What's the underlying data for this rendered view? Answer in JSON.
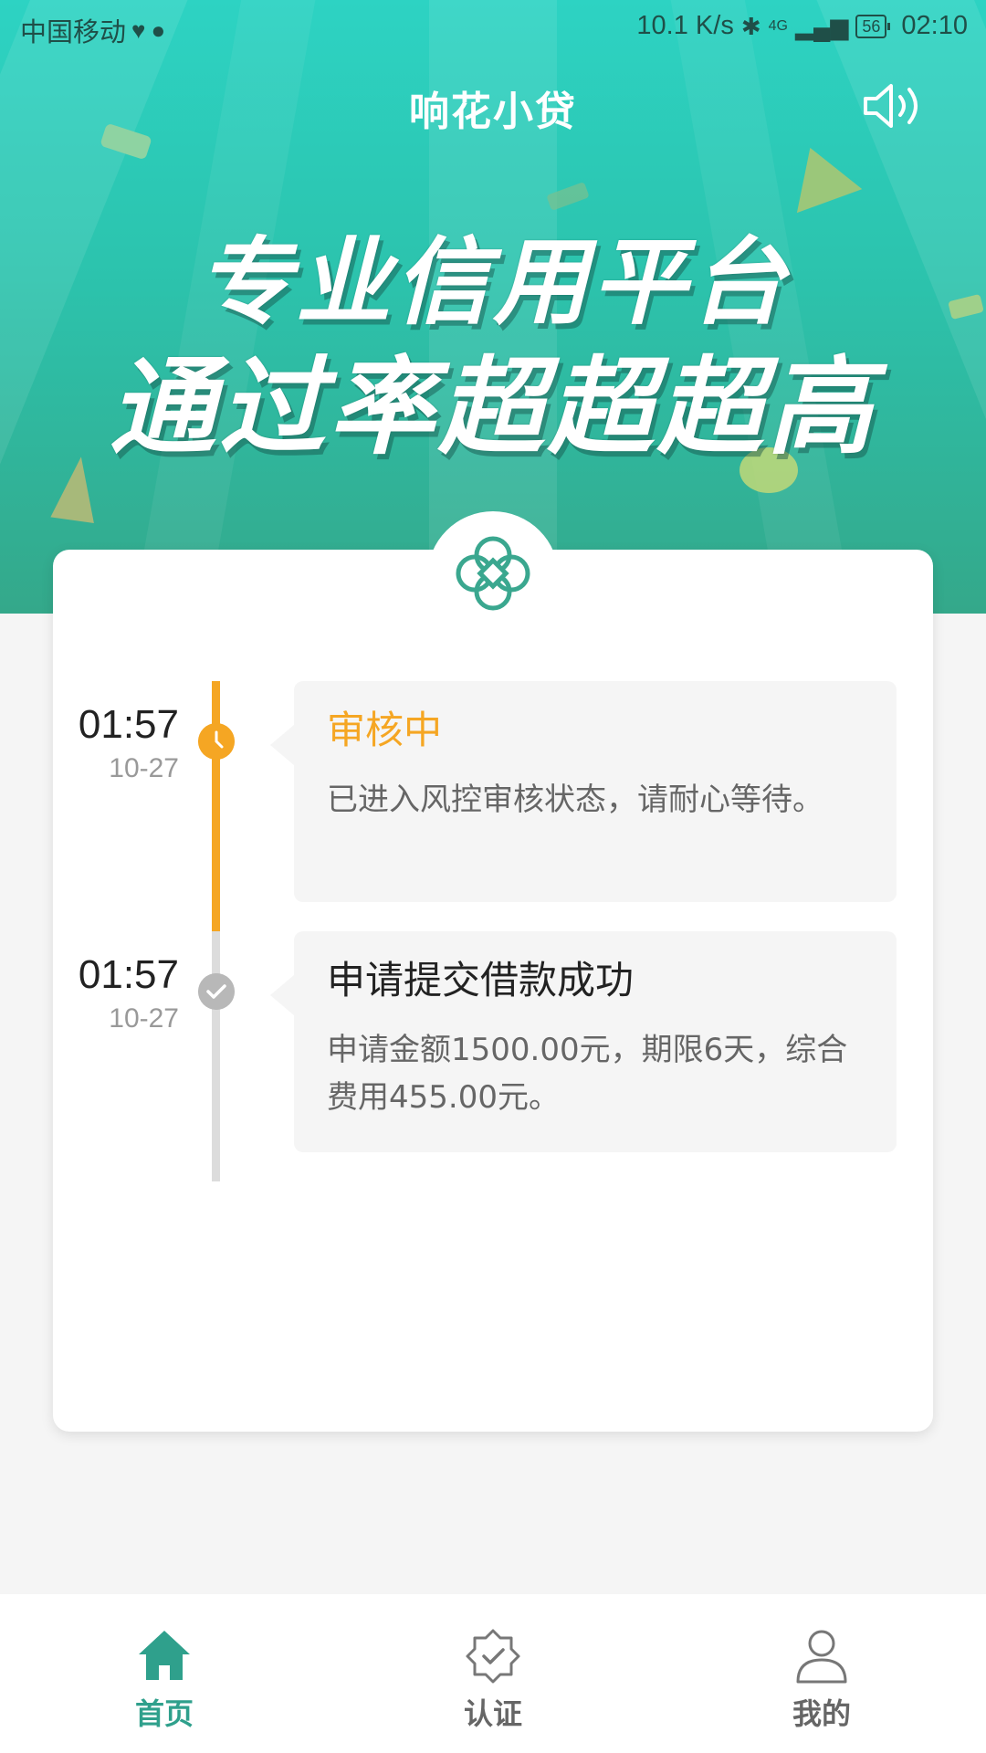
{
  "status_bar": {
    "carrier": "中国移动",
    "net_speed": "10.1 K/s",
    "network": "4G",
    "battery": "56",
    "time": "02:10"
  },
  "header": {
    "title": "响花小贷",
    "speaker_icon": "speaker-icon"
  },
  "banner": {
    "line1": "专业信用平台",
    "line2": "通过率超超超高"
  },
  "colors": {
    "accent": "#2fa08c",
    "pending": "#f5a623",
    "done": "#b8b8b8"
  },
  "timeline": [
    {
      "time": "01:57",
      "date": "10-27",
      "title": "审核中",
      "desc": "已进入风控审核状态，请耐心等待。",
      "state": "pending",
      "icon": "clock-icon"
    },
    {
      "time": "01:57",
      "date": "10-27",
      "title": "申请提交借款成功",
      "desc": "申请金额1500.00元，期限6天，综合费用455.00元。",
      "state": "done",
      "icon": "check-icon"
    }
  ],
  "nav": {
    "items": [
      {
        "label": "首页",
        "icon": "home-icon",
        "active": true
      },
      {
        "label": "认证",
        "icon": "verify-badge-icon",
        "active": false
      },
      {
        "label": "我的",
        "icon": "user-icon",
        "active": false
      }
    ]
  }
}
